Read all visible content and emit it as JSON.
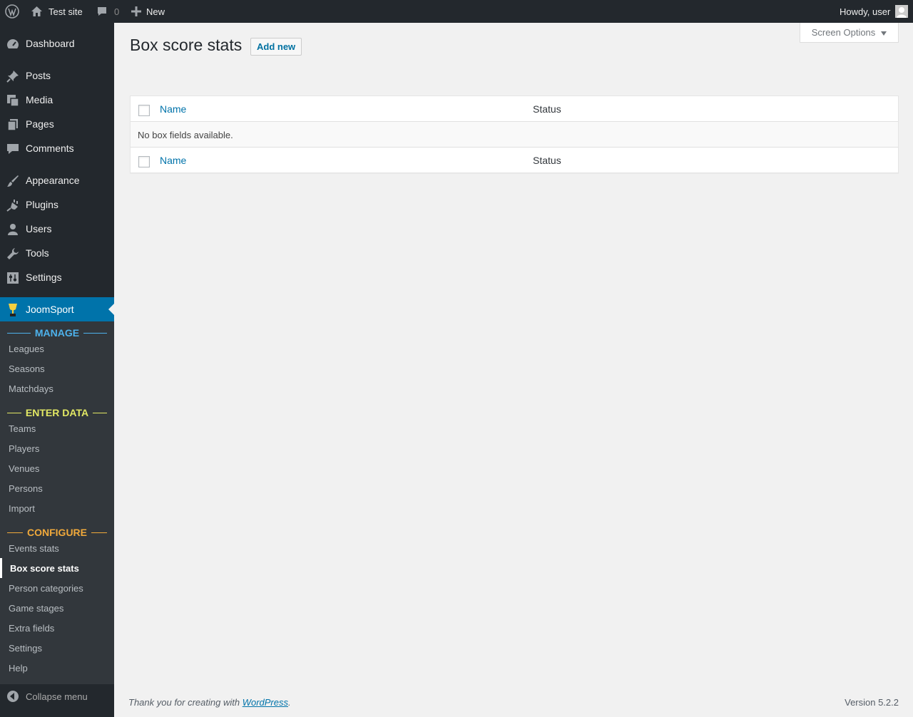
{
  "adminbar": {
    "site_name": "Test site",
    "comments_count": "0",
    "new_label": "New",
    "greeting": "Howdy, user"
  },
  "sidebar": {
    "items": [
      {
        "label": "Dashboard",
        "icon": "dashboard-icon"
      },
      {
        "label": "Posts",
        "icon": "pin-icon"
      },
      {
        "label": "Media",
        "icon": "media-icon"
      },
      {
        "label": "Pages",
        "icon": "pages-icon"
      },
      {
        "label": "Comments",
        "icon": "comment-icon"
      },
      {
        "label": "Appearance",
        "icon": "brush-icon"
      },
      {
        "label": "Plugins",
        "icon": "plug-icon"
      },
      {
        "label": "Users",
        "icon": "user-icon"
      },
      {
        "label": "Tools",
        "icon": "wrench-icon"
      },
      {
        "label": "Settings",
        "icon": "settings-icon"
      },
      {
        "label": "JoomSport",
        "icon": "trophy-icon"
      }
    ],
    "submenu": {
      "manage_heading": "MANAGE",
      "manage_color": "#4db2ec",
      "manage_items": [
        "Leagues",
        "Seasons",
        "Matchdays"
      ],
      "enter_heading": "ENTER DATA",
      "enter_color": "#e2e864",
      "enter_items": [
        "Teams",
        "Players",
        "Venues",
        "Persons",
        "Import"
      ],
      "configure_heading": "CONFIGURE",
      "configure_color": "#f0a93b",
      "configure_items": [
        "Events stats",
        "Box score stats",
        "Person categories",
        "Game stages",
        "Extra fields",
        "Settings",
        "Help"
      ]
    },
    "collapse_label": "Collapse menu"
  },
  "header": {
    "screen_options": "Screen Options",
    "title": "Box score stats",
    "add_new": "Add new"
  },
  "table": {
    "col_name": "Name",
    "col_status": "Status",
    "empty_message": "No box fields available."
  },
  "footer": {
    "thanks_prefix": "Thank you for creating with ",
    "thanks_link": "WordPress",
    "thanks_suffix": ".",
    "version": "Version 5.2.2"
  },
  "colors": {
    "accent": "#0073aa",
    "sidebar_bg": "#23282d",
    "submenu_bg": "#32373c"
  }
}
